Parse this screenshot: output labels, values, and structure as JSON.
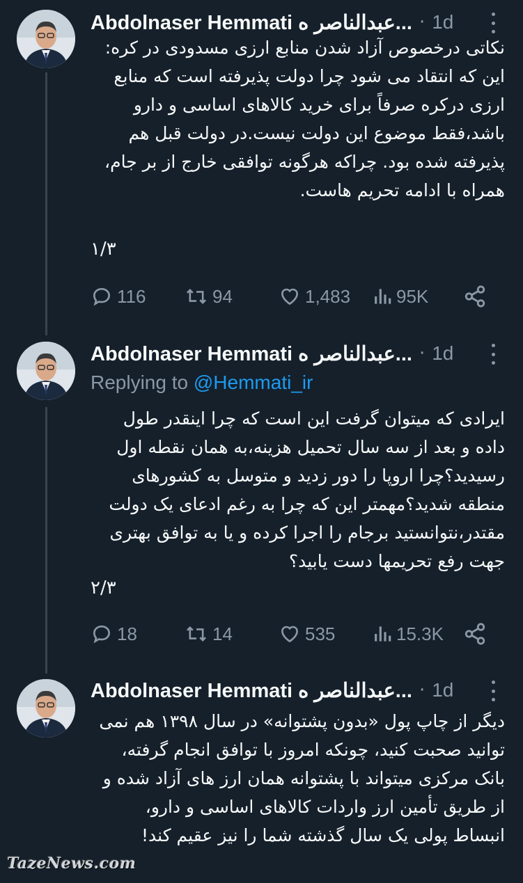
{
  "tweets": [
    {
      "author": "Abdolnaser Hemmati عبدالناصر ه...",
      "time": "1d",
      "replying_label": "",
      "replying_handle": "",
      "text": "نکاتی درخصوص آزاد شدن منابع ارزی مسدودی در کره:\nاین که انتقاد می شود چرا دولت پذیرفته است که منابع ارزی درکره صرفاً برای خرید کالاهای اساسی و دارو باشد،فقط موضوع این دولت نیست.در دولت قبل هم پذیرفته شده بود. چراکه هرگونه توافقی خارج از بر جام، همراه با ادامه تحریم هاست.",
      "counter": "۱/۳",
      "replies": "116",
      "retweets": "94",
      "likes": "1,483",
      "views": "95K"
    },
    {
      "author": "Abdolnaser Hemmati عبدالناصر ه...",
      "time": "1d",
      "replying_label": "Replying to",
      "replying_handle": "@Hemmati_ir",
      "text": "ایرادی که میتوان گرفت این است که چرا اینقدر طول داده و بعد از سه سال تحمیل هزینه،به همان نقطه اول رسیدید؟چرا اروپا را دور زدید و متوسل به کشورهای منطقه شدید؟مهمتر این که چرا به رغم ادعای یک دولت مقتدر،نتوانستید برجام را اجرا کرده و یا به توافق بهتری جهت رفع تحریمها دست یابید؟",
      "counter": "۲/۳",
      "replies": "18",
      "retweets": "14",
      "likes": "535",
      "views": "15.3K"
    },
    {
      "author": "Abdolnaser Hemmati عبدالناصر ه...",
      "time": "1d",
      "replying_label": "",
      "replying_handle": "",
      "text": "دیگر از چاپ پول «بدون پشتوانه» در سال ۱۳۹۸ هم نمی توانید صحبت کنید، چونکه امروز با توافق انجام گرفته، بانک مرکزی میتواند با پشتوانه همان ارز های آزاد شده و از طریق تأمین ارز واردات کالاهای اساسی و دارو، انبساط پولی یک سال گذشته شما را نیز عقیم کند!",
      "counter": "",
      "replies": "",
      "retweets": "",
      "likes": "",
      "views": ""
    }
  ],
  "watermark": "TazeNews.com",
  "colors": {
    "background": "#15202b",
    "text": "#f7f9f9",
    "muted": "#8b98a5",
    "link": "#1d9bf0",
    "thread_line": "#38444d"
  },
  "icons": [
    "reply-icon",
    "retweet-icon",
    "like-icon",
    "views-icon",
    "share-icon",
    "more-icon"
  ]
}
